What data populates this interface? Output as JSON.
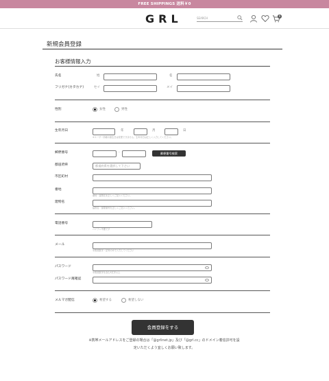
{
  "topbar": {
    "text": "FREE SHIPPINGS 送料￥0"
  },
  "header": {
    "logo": "GRL",
    "search_placeholder": "SEARCH",
    "cart_count": "0"
  },
  "page": {
    "title": "新規会員登録"
  },
  "section": {
    "title": "お客様情報入力"
  },
  "name": {
    "label": "氏名",
    "sei": "姓",
    "mei": "名"
  },
  "kana": {
    "label": "フリガナ(カタカナ)",
    "sei": "セイ",
    "mei": "メイ"
  },
  "gender": {
    "label": "性別",
    "female": "女性",
    "male": "男性"
  },
  "birth": {
    "label": "生年月日",
    "year": "年",
    "month": "月",
    "day": "日",
    "hint": "※ユーザー情報の誕生日は変更できません。生年月日は正しく入力してください。"
  },
  "zip": {
    "label": "郵便番号",
    "dash": "-",
    "button": "郵便番号検索"
  },
  "pref": {
    "label": "都道府県",
    "placeholder": "都道府県を選択して下さい"
  },
  "city": {
    "label": "市区町村"
  },
  "address": {
    "label": "番地",
    "hint": "番地・建物名を正しくご記入ください。"
  },
  "building": {
    "label": "建物名",
    "hint": "建物名・部屋番号を正しくご記入ください。"
  },
  "phone": {
    "label": "電話番号",
    "hint": "ハイフン不要です"
  },
  "email": {
    "label": "メール",
    "hint": "半角英数字・記号のみで入力してください"
  },
  "password": {
    "label": "パスワード",
    "hint": "半角英数字を含む8文字以上",
    "confirm_label": "パスワード再確認"
  },
  "magazine": {
    "label": "メルマガ配信",
    "yes": "希望する",
    "no": "希望しない"
  },
  "submit": {
    "label": "会員登録をする"
  },
  "footer": {
    "line1": "※携帯メールアドレスをご登録の場合は「@grlinet.jp」及び「@grl.cc」のドメイン着信許可を設",
    "line2": "定いただくよう宜しくお願い致します。"
  }
}
